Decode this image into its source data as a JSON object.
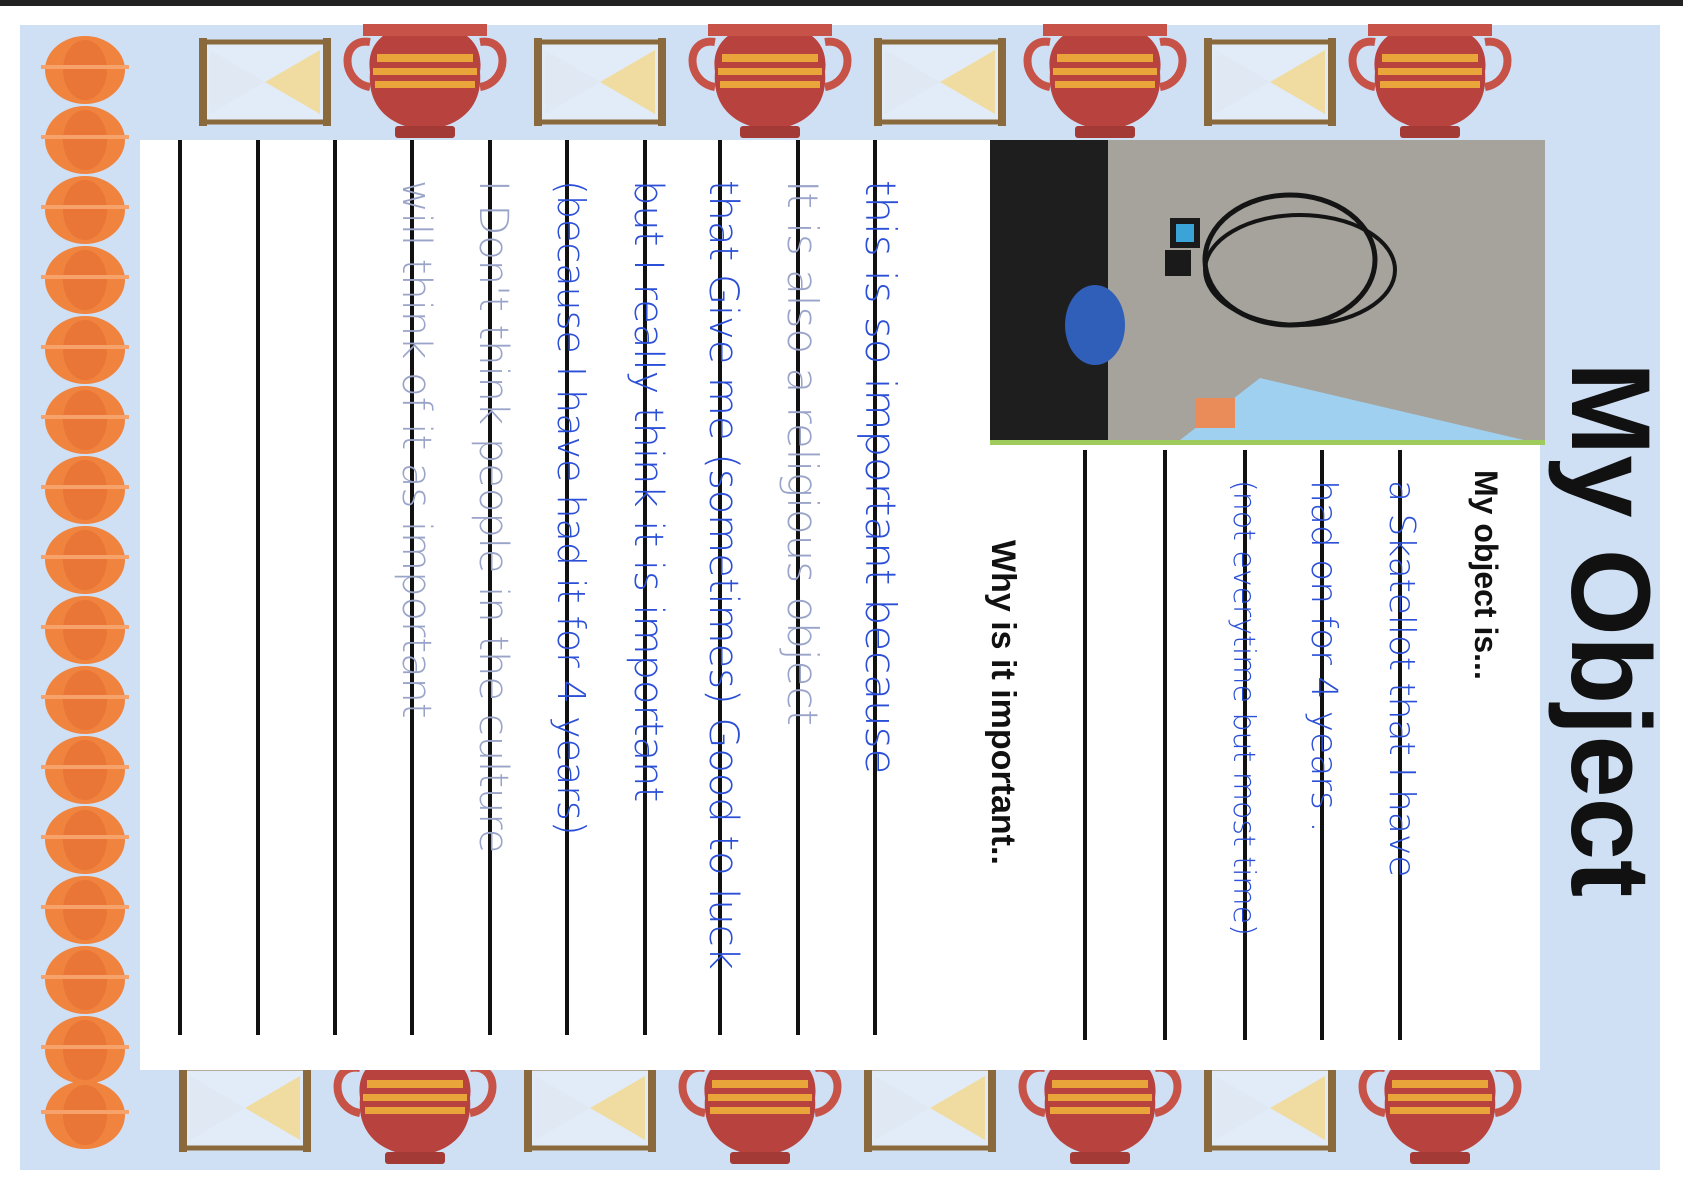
{
  "worksheet": {
    "title": "My Object",
    "prompt_object": "My object is...",
    "prompt_important": "Why is it important..",
    "colors": {
      "border_bg": "#cfe0f5",
      "vase_red": "#b8423e",
      "vase_band": "#e9a43a",
      "vase_orange": "#f0843f",
      "hourglass_frame": "#8a6a3c",
      "sand": "#f0dca0",
      "ink_blue": "#2b4fd6",
      "ink_light": "#9aa4c9"
    },
    "photo_icon": "necklace-photo"
  },
  "object_answer": {
    "lines": [
      "a Skatellot that I have",
      "had on for 4 years .",
      "(not everytime but most time)"
    ]
  },
  "important_answer": {
    "lines": [
      "this is so important because",
      "It is also a religious object",
      "that Give me (sometimes) Good to luck",
      "but I really think it is important",
      "(because I have had it for 4 years)",
      "I Don't think people in the culture",
      "will think of it as important"
    ]
  }
}
